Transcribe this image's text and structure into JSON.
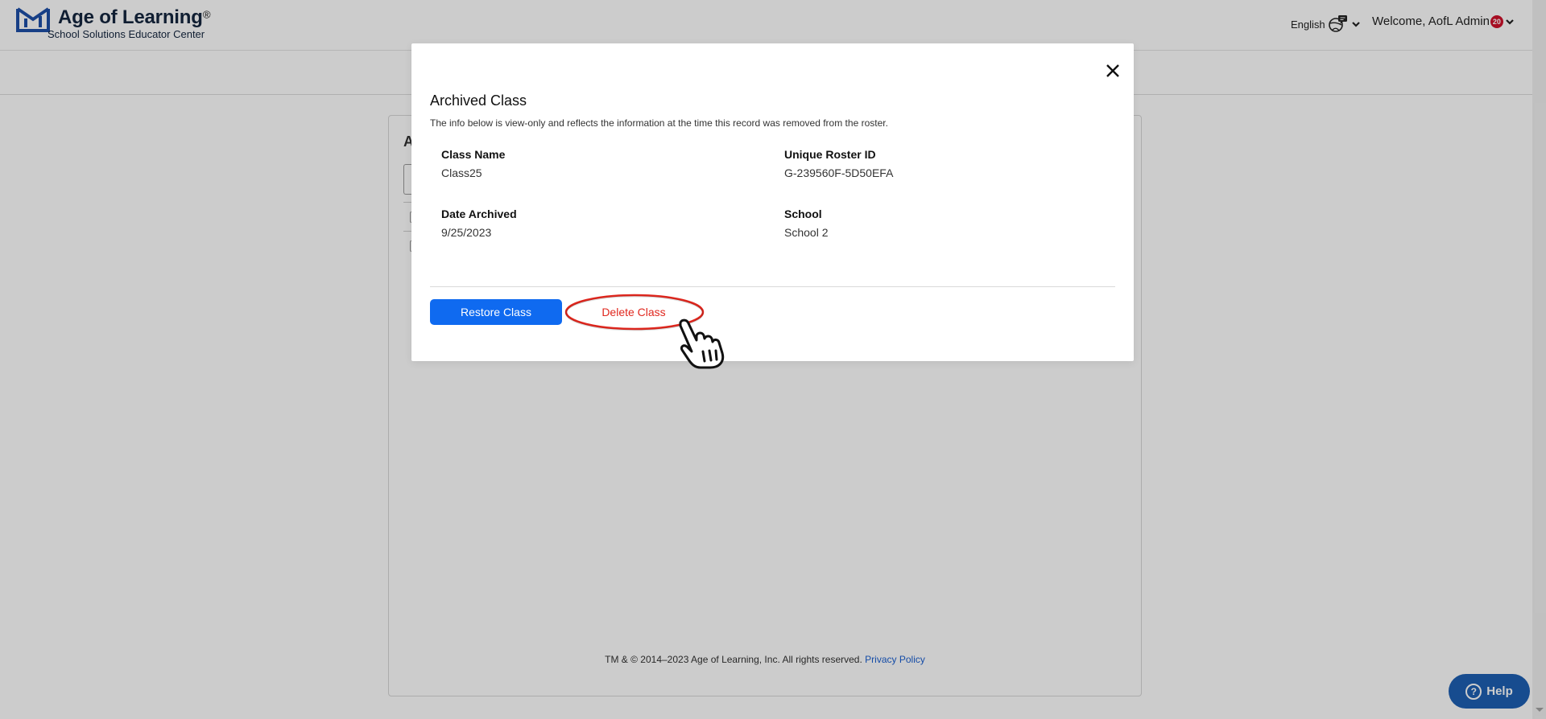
{
  "header": {
    "brand_title": "Age of Learning",
    "brand_mark": "®",
    "brand_subtitle": "School Solutions Educator Center",
    "language_label": "English",
    "language_icon": "globe-chat-icon",
    "welcome_text": "Welcome, AofL Admin",
    "notification_count": "20"
  },
  "background_page": {
    "heading_initial": "A",
    "footer_text": "TM & © 2014–2023 Age of Learning, Inc. All rights reserved.",
    "privacy_link": "Privacy Policy",
    "help_label": "Help"
  },
  "modal": {
    "title": "Archived Class",
    "description": "The info below is view-only and reflects the information at the time this record was removed from the roster.",
    "fields": [
      {
        "label": "Class Name",
        "value": "Class25"
      },
      {
        "label": "Unique Roster ID",
        "value": "G-239560F-5D50EFA"
      },
      {
        "label": "Date Archived",
        "value": "9/25/2023"
      },
      {
        "label": "School",
        "value": "School 2"
      }
    ],
    "restore_label": "Restore Class",
    "delete_label": "Delete Class"
  },
  "colors": {
    "primary": "#0f6af0",
    "danger": "#e0271e",
    "brand": "#1d4fa8",
    "help": "#1d5fb3",
    "badge": "#d0112b"
  }
}
